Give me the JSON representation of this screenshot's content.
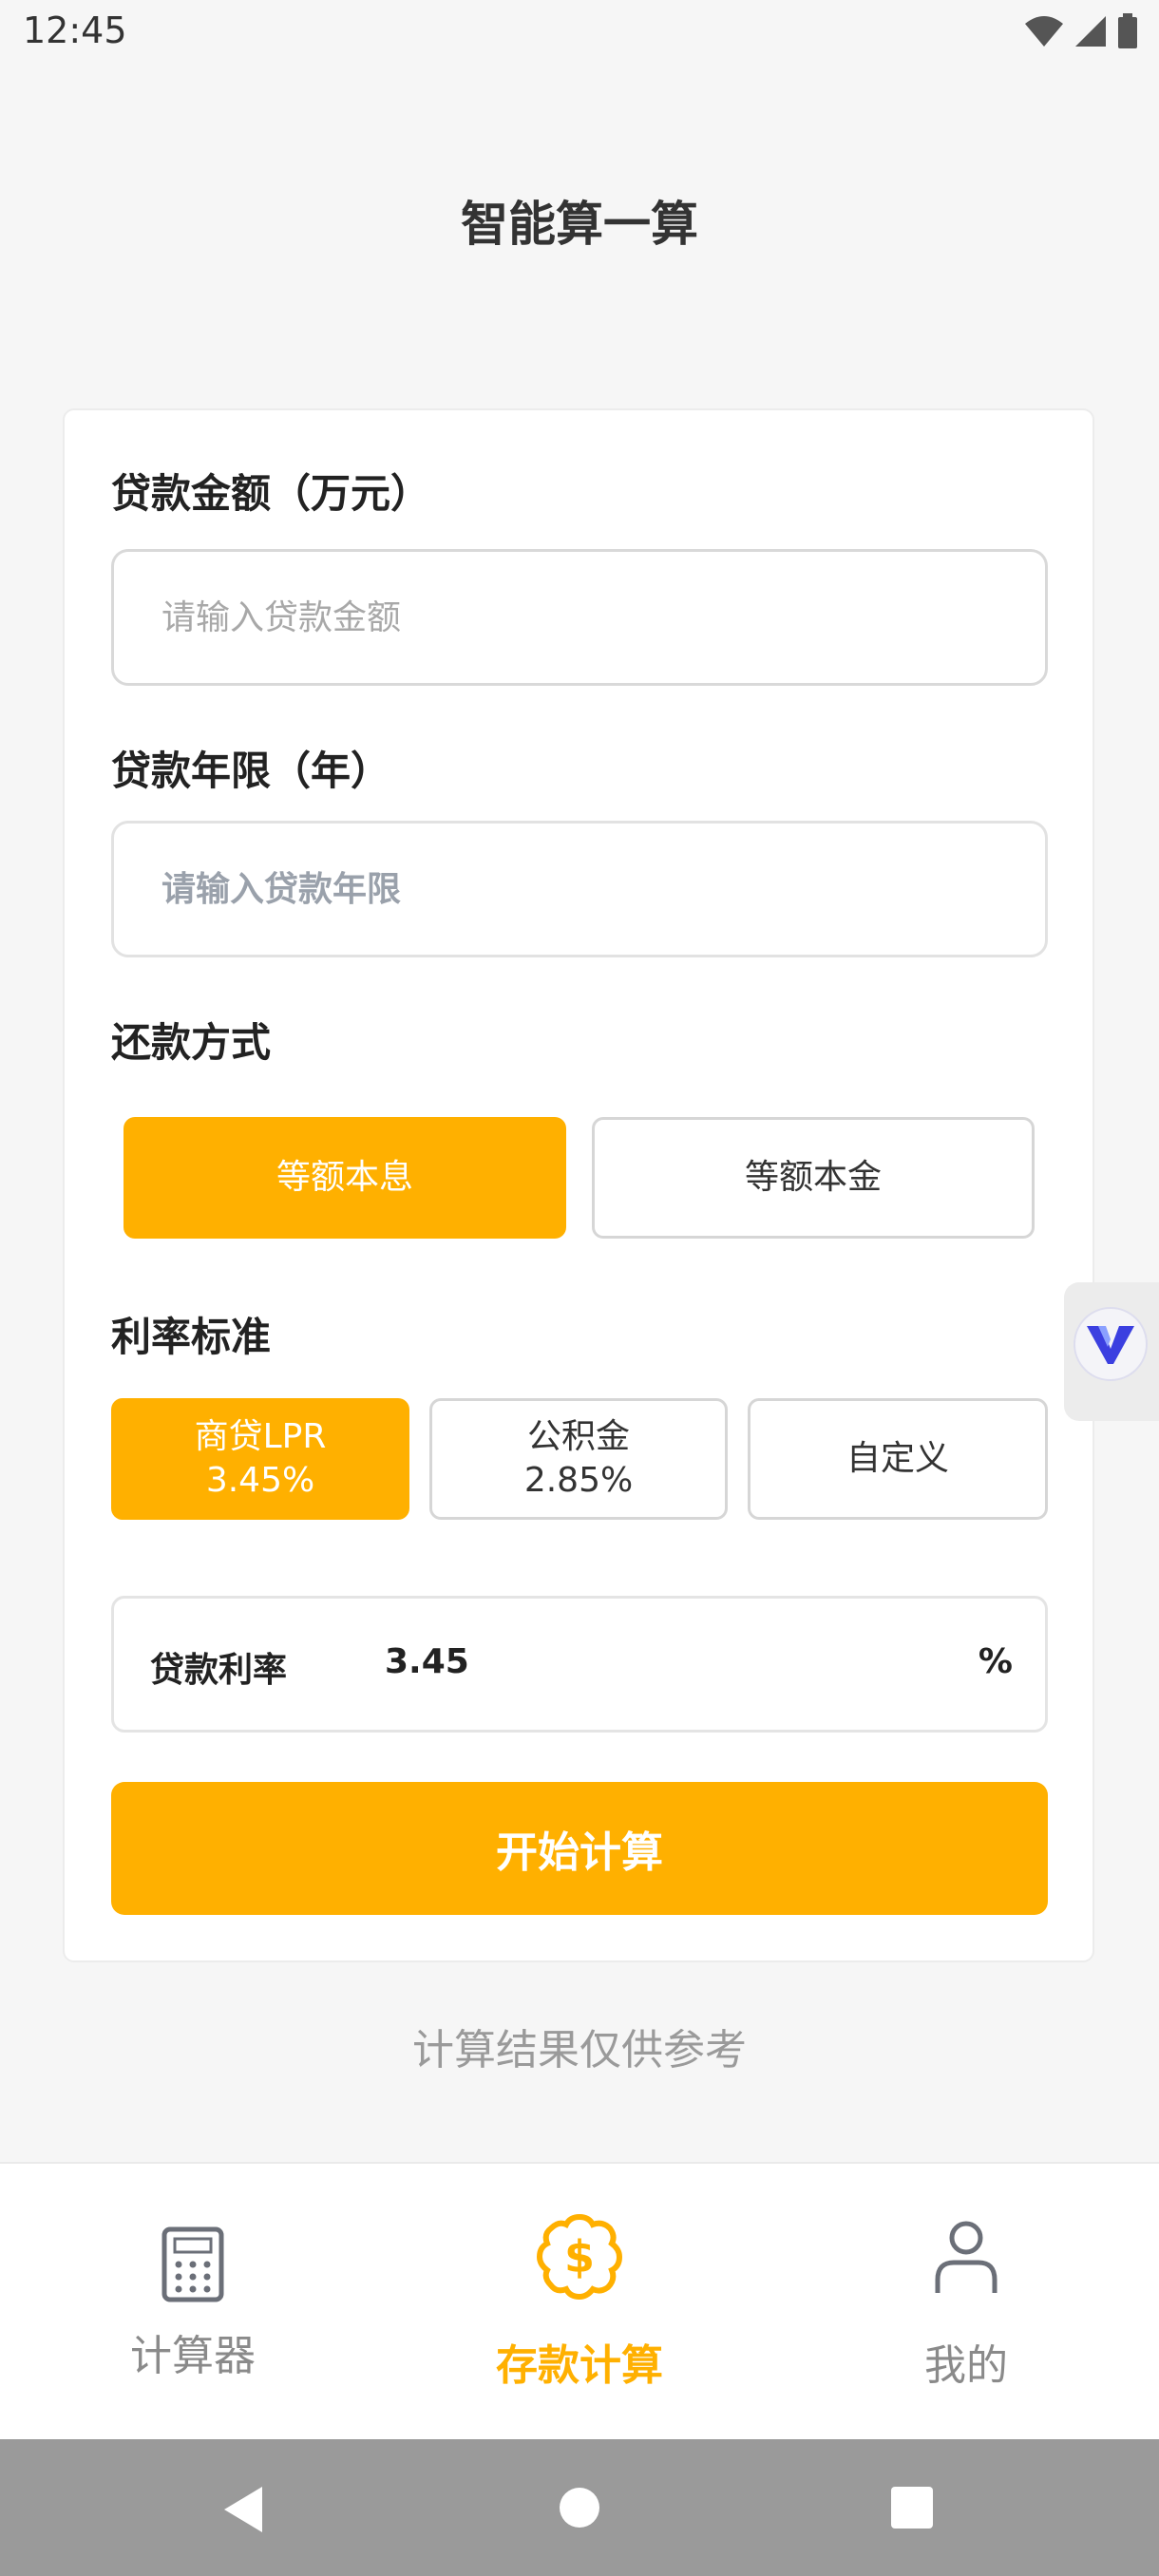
{
  "status_bar": {
    "time": "12:45"
  },
  "app": {
    "title": "智能算一算"
  },
  "loan_amount": {
    "label": "贷款金额（万元）",
    "placeholder": "请输入贷款金额",
    "value": ""
  },
  "loan_years": {
    "label": "贷款年限（年）",
    "placeholder": "请输入贷款年限",
    "value": ""
  },
  "repayment": {
    "label": "还款方式",
    "options": [
      {
        "label": "等额本息",
        "selected": true
      },
      {
        "label": "等额本金",
        "selected": false
      }
    ]
  },
  "rate_standard": {
    "label": "利率标准",
    "options": [
      {
        "line1": "商贷LPR",
        "line2": "3.45%",
        "selected": true
      },
      {
        "line1": "公积金",
        "line2": "2.85%",
        "selected": false
      },
      {
        "line1": "自定义",
        "line2": "",
        "selected": false
      }
    ]
  },
  "rate_field": {
    "label": "贷款利率",
    "value": "3.45",
    "unit": "%"
  },
  "calculate_button": {
    "label": "开始计算"
  },
  "disclaimer": "计算结果仅供参考",
  "bottom_nav": {
    "items": [
      {
        "label": "计算器",
        "icon": "calculator-icon",
        "active": false
      },
      {
        "label": "存款计算",
        "icon": "dollar-coin-icon",
        "active": true
      },
      {
        "label": "我的",
        "icon": "user-icon",
        "active": false
      }
    ]
  },
  "colors": {
    "accent": "#ffb000",
    "inactive_text": "#8a8a8a",
    "background": "#f6f6f6"
  }
}
